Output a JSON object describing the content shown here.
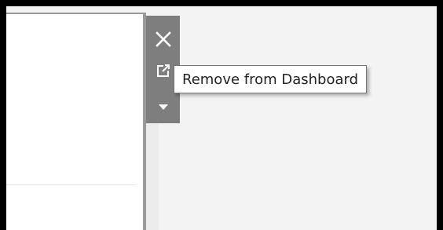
{
  "tooltip": {
    "text": "Remove from Dashboard"
  },
  "toolbar": {
    "buttons": [
      {
        "icon": "close-icon"
      },
      {
        "icon": "open-in-new-icon"
      },
      {
        "icon": "dropdown-arrow-icon"
      }
    ]
  },
  "colors": {
    "toolbar_bg": "#7e7e7e",
    "stage_bg": "#f3f3f3",
    "panel_bg": "#ffffff",
    "frame": "#000000"
  }
}
